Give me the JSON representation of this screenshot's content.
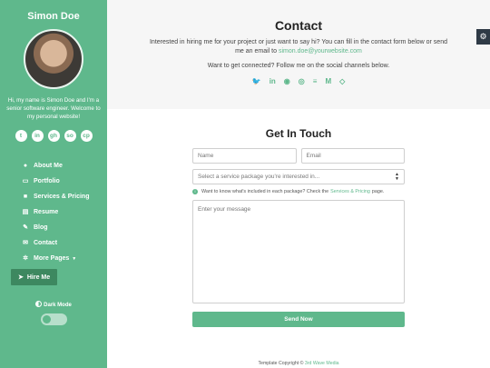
{
  "sidebar": {
    "name": "Simon Doe",
    "bio": "Hi, my name is Simon Doe and I'm a senior software engineer. Welcome to my personal website!",
    "social": [
      {
        "icon": "twitter-icon",
        "glyph": "t"
      },
      {
        "icon": "linkedin-icon",
        "glyph": "in"
      },
      {
        "icon": "github-icon",
        "glyph": "gh"
      },
      {
        "icon": "stack-overflow-icon",
        "glyph": "so"
      },
      {
        "icon": "codepen-icon",
        "glyph": "cp"
      }
    ],
    "nav": [
      {
        "label": "About Me",
        "icon": "user-icon"
      },
      {
        "label": "Portfolio",
        "icon": "laptop-icon"
      },
      {
        "label": "Services & Pricing",
        "icon": "briefcase-icon"
      },
      {
        "label": "Resume",
        "icon": "file-icon"
      },
      {
        "label": "Blog",
        "icon": "blog-icon"
      },
      {
        "label": "Contact",
        "icon": "envelope-icon"
      },
      {
        "label": "More Pages",
        "icon": "cogs-icon"
      }
    ],
    "hire_label": "Hire Me",
    "dark_mode_label": "Dark Mode",
    "dark_mode_on": false
  },
  "header": {
    "title": "Contact",
    "intro": "Interested in hiring me for your project or just want to say hi? You can fill in the contact form below or send me an email to",
    "email": "simon.doe@yourwebsite.com",
    "connect": "Want to get connected? Follow me on the social channels below.",
    "social_icons": [
      "twitter-icon",
      "linkedin-icon",
      "github-icon",
      "instagram-icon",
      "stack-overflow-icon",
      "medium-icon",
      "codepen-icon"
    ]
  },
  "form": {
    "title": "Get In Touch",
    "name_placeholder": "Name",
    "email_placeholder": "Email",
    "select_value": "Select a service package you're interested in...",
    "hint_before": "Want to know what's included in each package? Check the",
    "hint_link": "Services & Pricing",
    "hint_after": "page.",
    "message_placeholder": "Enter your message",
    "send_label": "Send Now"
  },
  "footer": {
    "text": "Template Copyright ©",
    "link": "3rd Wave Media"
  },
  "colors": {
    "accent": "#5fb88c",
    "hire_button": "#3d8860",
    "settings_tab": "#2f3a46"
  }
}
